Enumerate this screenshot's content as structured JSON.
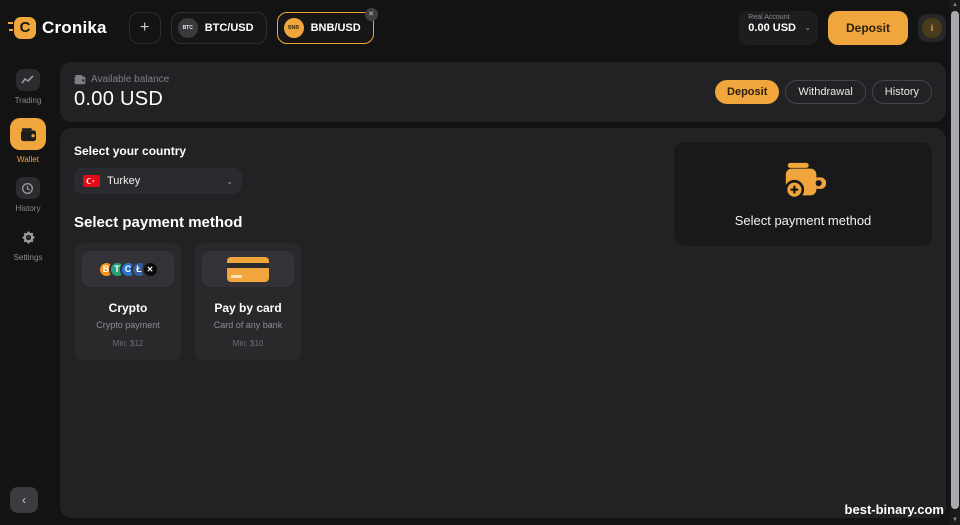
{
  "header": {
    "logo_text": "Cronika",
    "logo_letter": "C",
    "add_tab_label": "+",
    "tabs": [
      {
        "symbol": "BTC/USD",
        "coin": "BTC"
      },
      {
        "symbol": "BNB/USD",
        "coin": "BNB",
        "close_label": "✕"
      }
    ],
    "account": {
      "type_label": "Real Account",
      "balance": "0.00 USD",
      "chevron": "⌄"
    },
    "deposit_label": "Deposit",
    "profile_glyph": "i"
  },
  "sidebar": {
    "items": [
      {
        "label": "Trading"
      },
      {
        "label": "Wallet"
      },
      {
        "label": "History"
      },
      {
        "label": "Settings"
      }
    ],
    "collapse_glyph": "‹"
  },
  "balance_panel": {
    "label": "Available balance",
    "amount": "0.00 USD",
    "buttons": {
      "deposit": "Deposit",
      "withdrawal": "Withdrawal",
      "history": "History"
    }
  },
  "main": {
    "country_section_title": "Select your country",
    "country_selected": "Turkey",
    "country_chevron": "⌄",
    "payment_section_title": "Select payment method",
    "payment_methods": [
      {
        "name": "Crypto",
        "description": "Crypto payment",
        "min": "Min: $12"
      },
      {
        "name": "Pay by card",
        "description": "Card of any bank",
        "min": "Min: $10"
      }
    ],
    "crypto_coins": [
      {
        "symbol": "B",
        "color": "#F7931A"
      },
      {
        "symbol": "T",
        "color": "#26A17B"
      },
      {
        "symbol": "C",
        "color": "#2775CA"
      },
      {
        "symbol": "Ł",
        "color": "#345D9D"
      }
    ],
    "crypto_more_label": "✕",
    "placeholder_panel": {
      "label": "Select payment method"
    }
  },
  "watermark": "best-binary.com",
  "colors": {
    "accent": "#F0A63C",
    "panel": "#222225",
    "page": "#131314"
  }
}
